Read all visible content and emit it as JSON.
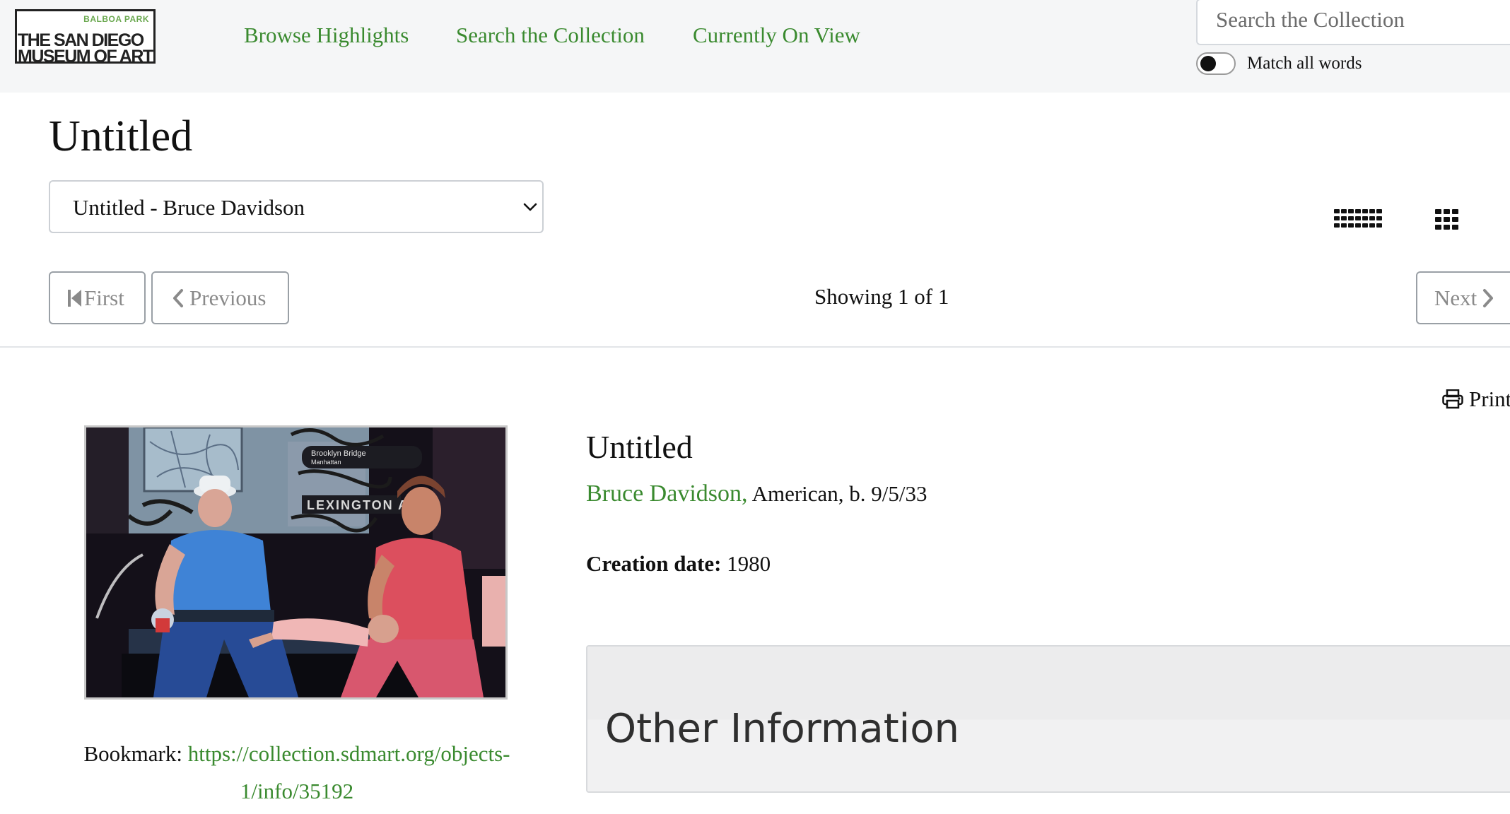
{
  "header": {
    "logo": {
      "tag": "BALBOA PARK",
      "line1": "THE SAN DIEGO",
      "line2": "MUSEUM OF ART"
    },
    "nav": [
      {
        "label": "Browse Highlights"
      },
      {
        "label": "Search the Collection"
      },
      {
        "label": "Currently On View"
      }
    ],
    "search": {
      "placeholder": "Search the Collection",
      "value": ""
    },
    "match_toggle": {
      "label": "Match all words",
      "on": false
    }
  },
  "title_area": {
    "title": "Untitled",
    "select": {
      "selected": "Untitled - Bruce Davidson"
    },
    "view_icons": [
      "grid-small-icon",
      "grid-large-icon"
    ]
  },
  "pagination": {
    "first_label": "First",
    "previous_label": "Previous",
    "status": "Showing 1 of 1",
    "next_label": "Next"
  },
  "print_label": "Print",
  "object": {
    "title": "Untitled",
    "artist": "Bruce Davidson,",
    "artist_detail": "American, b. 9/5/33",
    "creation_label": "Creation date:",
    "creation_value": "1980",
    "bookmark_label": "Bookmark:",
    "bookmark_url": "https://collection.sdmart.org/objects-1/info/35192",
    "image_signs": {
      "sign1_line1": "Brooklyn Bridge",
      "sign1_line2": "Manhattan",
      "sign2": "LEXINGTON AV"
    }
  },
  "other_info": {
    "title": "Other Information"
  },
  "colors": {
    "link_green": "#3a8a2f",
    "header_bg": "#f5f6f7",
    "muted_button_text": "#8a8a8a"
  }
}
